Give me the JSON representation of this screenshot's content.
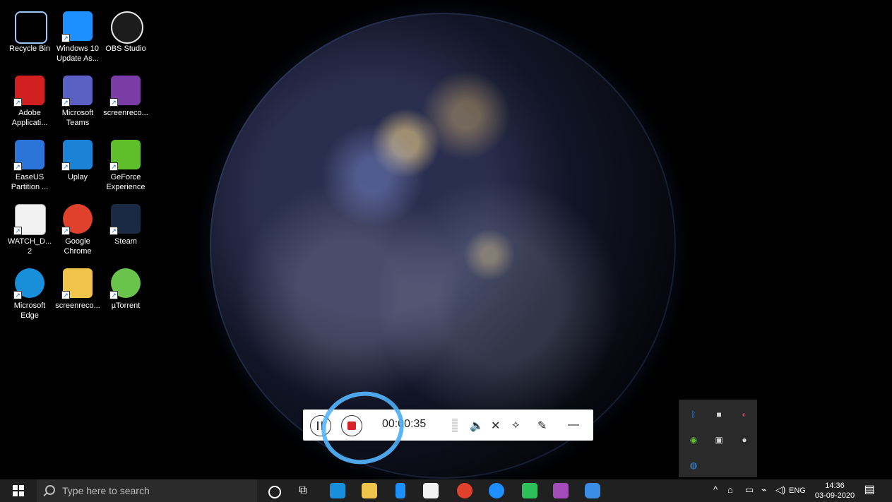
{
  "desktop": {
    "icons": [
      {
        "label": "Recycle Bin",
        "icon": "recycle-bin-icon",
        "color": "#9fc7ff"
      },
      {
        "label": "Windows 10\nUpdate As...",
        "icon": "windows-update-icon",
        "color": "#1e8fff"
      },
      {
        "label": "OBS Studio",
        "icon": "obs-icon",
        "color": "#1c1c1c"
      },
      {
        "label": "Adobe\nApplicati...",
        "icon": "adobe-icon",
        "color": "#d21f1f"
      },
      {
        "label": "Microsoft\nTeams",
        "icon": "teams-icon",
        "color": "#5b60c4"
      },
      {
        "label": "screenreco...",
        "icon": "archive-icon",
        "color": "#7a3da8"
      },
      {
        "label": "EaseUS\nPartition ...",
        "icon": "easeus-icon",
        "color": "#2a74d8"
      },
      {
        "label": "Uplay",
        "icon": "uplay-icon",
        "color": "#1a83d6"
      },
      {
        "label": "GeForce\nExperience",
        "icon": "geforce-icon",
        "color": "#5fbf2b"
      },
      {
        "label": "WATCH_D...\n2",
        "icon": "watchdogs-icon",
        "color": "#e8e8e8"
      },
      {
        "label": "Google\nChrome",
        "icon": "chrome-icon",
        "color": "#e0412c"
      },
      {
        "label": "Steam",
        "icon": "steam-icon",
        "color": "#1b2a44"
      },
      {
        "label": "Microsoft\nEdge",
        "icon": "edge-icon",
        "color": "#1a8fd9"
      },
      {
        "label": "screenreco...",
        "icon": "folder-icon",
        "color": "#f0c44a"
      },
      {
        "label": "µTorrent",
        "icon": "utorrent-icon",
        "color": "#6ac44b"
      }
    ]
  },
  "recorder": {
    "time": "00:00:35",
    "tools": [
      {
        "icon": "speaker-icon",
        "glyph": "🔈"
      },
      {
        "icon": "mic-muted-icon",
        "glyph": "✕"
      },
      {
        "icon": "camera-muted-icon",
        "glyph": "⟡"
      },
      {
        "icon": "pen-icon",
        "glyph": "✎"
      },
      {
        "icon": "minimize-icon",
        "glyph": "—"
      }
    ]
  },
  "taskbar": {
    "search_placeholder": "Type here to search",
    "lang": "ENG",
    "time": "14:36",
    "date": "03-09-2020"
  },
  "tray_popup": {
    "icons": [
      {
        "icon": "bluetooth-icon",
        "color": "#2f7de1",
        "glyph": "ᛒ"
      },
      {
        "icon": "security-icon",
        "color": "#d6d6d6",
        "glyph": "■"
      },
      {
        "icon": "adobe-cc-icon",
        "color": "#e03a53",
        "glyph": "◐"
      },
      {
        "icon": "nvidia-icon",
        "color": "#5fbf2b",
        "glyph": "◉"
      },
      {
        "icon": "display-icon",
        "color": "#d6d6d6",
        "glyph": "▣"
      },
      {
        "icon": "evernote-icon",
        "color": "#d6d6d6",
        "glyph": "●"
      },
      {
        "icon": "meet-icon",
        "color": "#3a8ee6",
        "glyph": "◍"
      }
    ]
  }
}
